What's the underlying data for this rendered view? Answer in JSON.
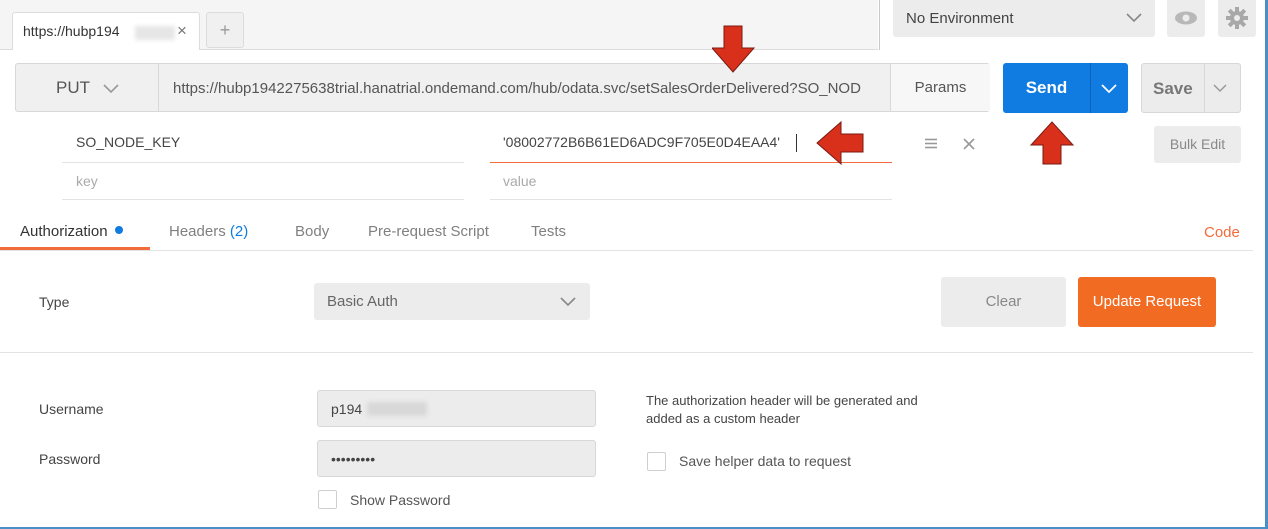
{
  "tab": {
    "label": "https://hubp194",
    "close": "×",
    "add": "+"
  },
  "environment": {
    "label": "No Environment"
  },
  "request": {
    "method": "PUT",
    "url": "https://hubp1942275638trial.hanatrial.ondemand.com/hub/odata.svc/setSalesOrderDelivered?SO_NOD",
    "params_label": "Params",
    "send_label": "Send",
    "save_label": "Save"
  },
  "params": {
    "key": "SO_NODE_KEY",
    "value": "'08002772B6B61ED6ADC9F705E0D4EAA4'",
    "key_placeholder": "key",
    "value_placeholder": "value",
    "bulk_edit": "Bulk Edit"
  },
  "subtabs": {
    "authorization": "Authorization",
    "headers": "Headers",
    "headers_count": "(2)",
    "body": "Body",
    "prerequest": "Pre-request Script",
    "tests": "Tests",
    "code": "Code"
  },
  "auth": {
    "type_label": "Type",
    "type_value": "Basic Auth",
    "clear": "Clear",
    "update": "Update Request",
    "username_label": "Username",
    "username_value": "p194",
    "password_label": "Password",
    "password_value": "•••••••••",
    "show_password": "Show Password",
    "note": "The authorization header will be generated and added as a custom header",
    "save_helper": "Save helper data to request"
  },
  "colors": {
    "accent_blue": "#107be0",
    "accent_orange": "#f26b22",
    "arrow_red": "#d9301c"
  }
}
